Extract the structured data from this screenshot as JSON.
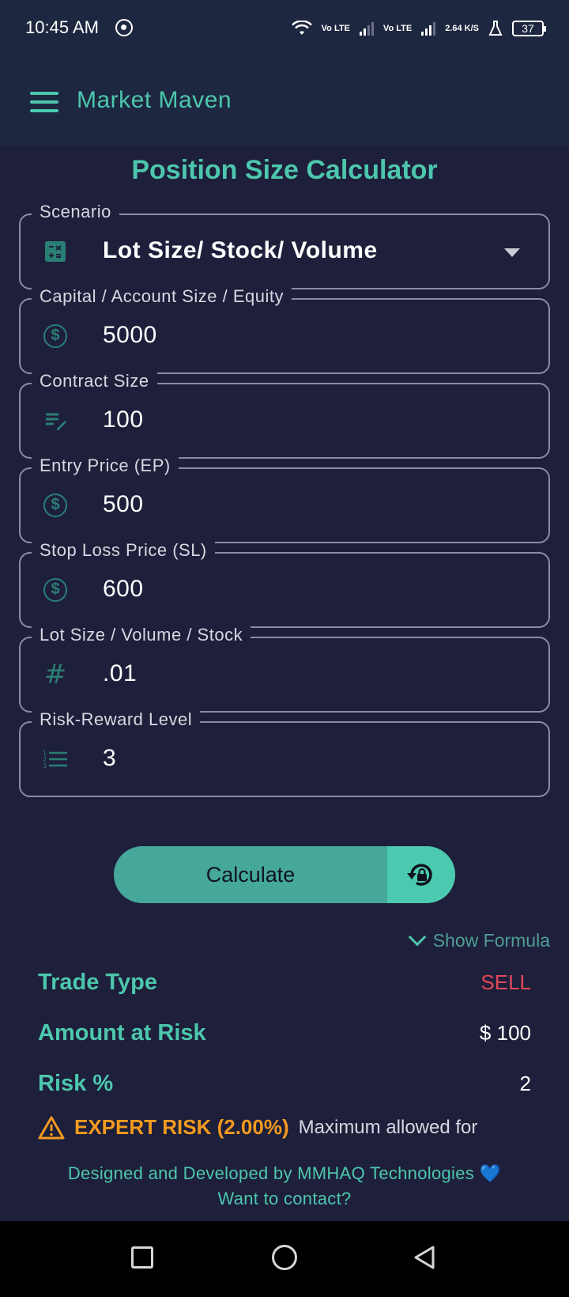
{
  "status_bar": {
    "time": "10:45 AM",
    "volte_1": "Vo LTE",
    "volte_2": "Vo LTE",
    "speed": "2.64 K/S",
    "battery": "37"
  },
  "app": {
    "title": "Market Maven",
    "menu_icon": "hamburger-menu-icon"
  },
  "page": {
    "title": "Position Size Calculator"
  },
  "fields": {
    "scenario": {
      "label": "Scenario",
      "value": "Lot Size/ Stock/ Volume",
      "icon": "calculator-icon"
    },
    "capital": {
      "label": "Capital / Account Size / Equity",
      "value": "5000",
      "icon": "dollar-icon"
    },
    "contract": {
      "label": "Contract Size",
      "value": "100",
      "icon": "edit-note-icon"
    },
    "entry": {
      "label": "Entry Price (EP)",
      "value": "500",
      "icon": "dollar-icon"
    },
    "stoploss": {
      "label": "Stop Loss Price (SL)",
      "value": "600",
      "icon": "dollar-icon"
    },
    "lot": {
      "label": "Lot Size / Volume / Stock",
      "value": ".01",
      "icon": "hash-icon"
    },
    "rr": {
      "label": "Risk-Reward Level",
      "value": "3",
      "icon": "numbered-list-icon"
    }
  },
  "actions": {
    "calculate": "Calculate",
    "reset_icon": "lock-reset-icon",
    "show_formula": "Show Formula"
  },
  "results": {
    "trade_type_label": "Trade Type",
    "trade_type_value": "SELL",
    "amount_label": "Amount at Risk",
    "amount_value": "$ 100",
    "risk_label": "Risk %",
    "risk_value": "2",
    "warning_strong": "EXPERT RISK (2.00%)",
    "warning_note": "Maximum allowed for"
  },
  "footer": {
    "credit": "Designed and Developed by MMHAQ Technologies 💙",
    "contact": "Want to contact?"
  },
  "colors": {
    "accent": "#4cc7ad",
    "background": "#1e1f3a",
    "appbar": "#1e2740",
    "sell": "#e3485a",
    "warning": "#f29a1f"
  }
}
